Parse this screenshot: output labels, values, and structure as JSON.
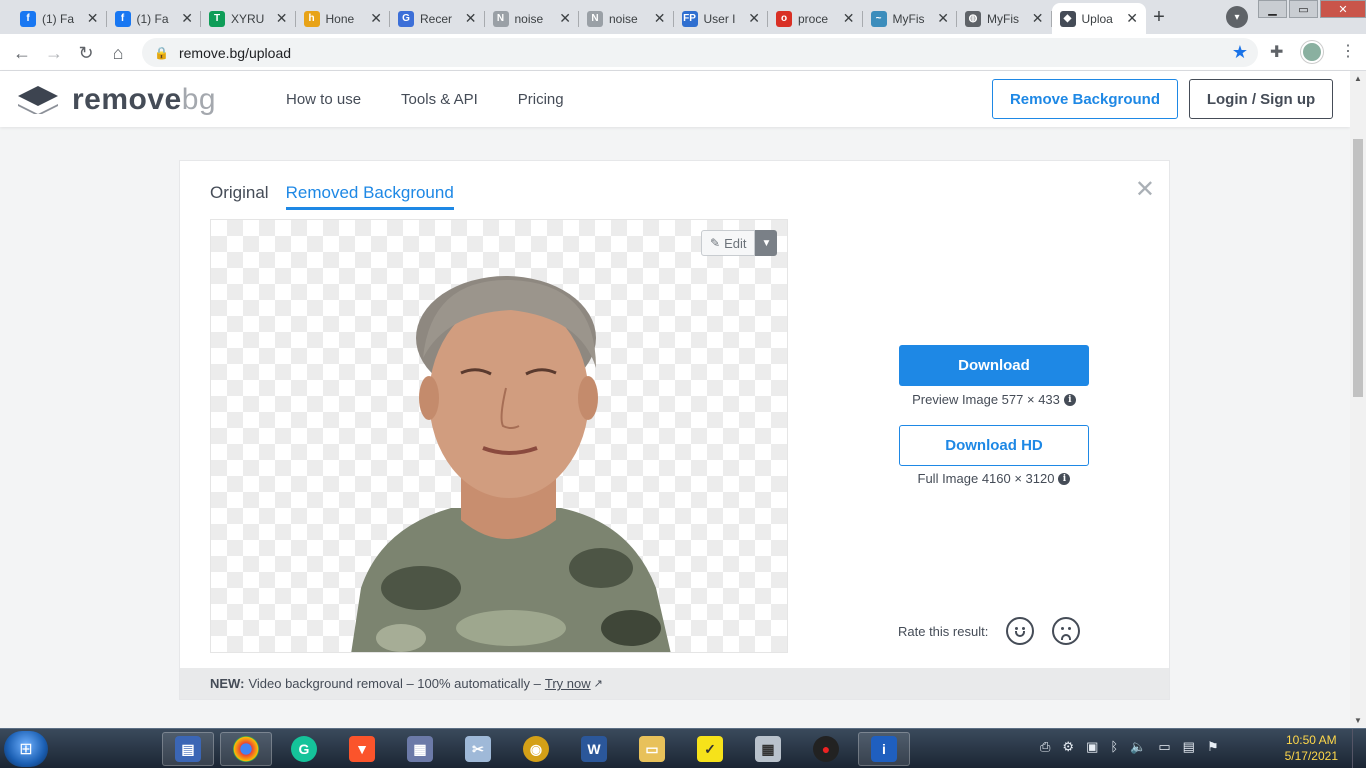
{
  "browser": {
    "tabs": [
      {
        "title": "(1) Fa",
        "icon": "facebook-icon",
        "color": "#1877f2",
        "glyph": "f"
      },
      {
        "title": "(1) Fa",
        "icon": "facebook-icon",
        "color": "#1877f2",
        "glyph": "f"
      },
      {
        "title": "XYRU",
        "icon": "sheets-icon",
        "color": "#0f9d58",
        "glyph": "T"
      },
      {
        "title": "Hone",
        "icon": "honey-icon",
        "color": "#e8a317",
        "glyph": "h"
      },
      {
        "title": "Recer",
        "icon": "google-icon",
        "color": "#3c6fd8",
        "glyph": "G"
      },
      {
        "title": "noise",
        "icon": "noise-icon",
        "color": "#9aa0a6",
        "glyph": "N"
      },
      {
        "title": "noise",
        "icon": "noise-icon",
        "color": "#9aa0a6",
        "glyph": "N"
      },
      {
        "title": "User I",
        "icon": "fp-icon",
        "color": "#2f6fd0",
        "glyph": "FP"
      },
      {
        "title": "proce",
        "icon": "opera-icon",
        "color": "#d93025",
        "glyph": "o"
      },
      {
        "title": "MyFis",
        "icon": "fish-icon",
        "color": "#3c8dbc",
        "glyph": "~"
      },
      {
        "title": "MyFis",
        "icon": "globe-icon",
        "color": "#5f6368",
        "glyph": "◍"
      },
      {
        "title": "Uploa",
        "icon": "removebg-icon",
        "color": "#454c57",
        "glyph": "◆"
      }
    ],
    "close_glyph": "✕",
    "new_tab": "+",
    "url": "remove.bg/upload"
  },
  "site": {
    "logo_main": "remove",
    "logo_accent": "bg",
    "nav": [
      "How to use",
      "Tools & API",
      "Pricing"
    ],
    "remove_bg_button": "Remove Background",
    "login_button": "Login / Sign up"
  },
  "result": {
    "tab_original": "Original",
    "tab_removed": "Removed Background",
    "edit_label": "Edit",
    "download_label": "Download",
    "preview_caption": "Preview Image 577 × 433",
    "download_hd_label": "Download HD",
    "full_caption": "Full Image 4160 × 3120",
    "rate_label": "Rate this result:",
    "footer_new": "NEW:",
    "footer_text": "Video background removal – 100% automatically –",
    "footer_link": "Try now"
  },
  "taskbar": {
    "time": "10:50 AM",
    "date": "5/17/2021"
  }
}
